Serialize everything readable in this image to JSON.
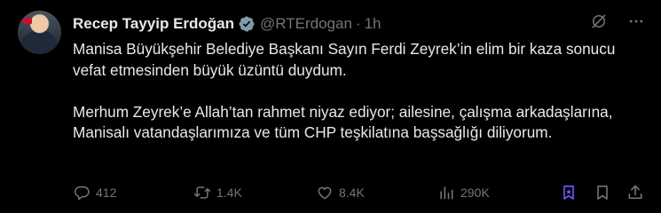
{
  "author": {
    "name": "Recep Tayyip Erdoğan",
    "handle": "@RTErdogan",
    "separator": "·",
    "time": "1h"
  },
  "tweet": {
    "text": "Manisa Büyükşehir Belediye Başkanı Sayın Ferdi Zeyrek’in elim bir kaza sonucu vefat etmesinden büyük üzüntü duydum.\n\nMerhum Zeyrek’e Allah’tan rahmet niyaz ediyor; ailesine, çalışma arkadaşlarına, Manisalı vatandaşlarımıza ve tüm CHP teşkilatına başsağlığı diliyorum."
  },
  "actions": {
    "replies": "412",
    "reposts": "1.4K",
    "likes": "8.4K",
    "views": "290K"
  },
  "icons": {
    "verified": "verified-badge-icon",
    "grok": "grok-icon",
    "more": "more-icon",
    "reply": "reply-icon",
    "repost": "repost-icon",
    "like": "heart-icon",
    "views": "views-icon",
    "bookmark_highlight": "bookmark-highlight-icon",
    "bookmark": "bookmark-icon",
    "share": "share-icon"
  },
  "colors": {
    "background": "#000000",
    "text": "#e7e9ea",
    "muted": "#71767b",
    "verified_badge": "#829aab",
    "accent": "#7856ff"
  }
}
